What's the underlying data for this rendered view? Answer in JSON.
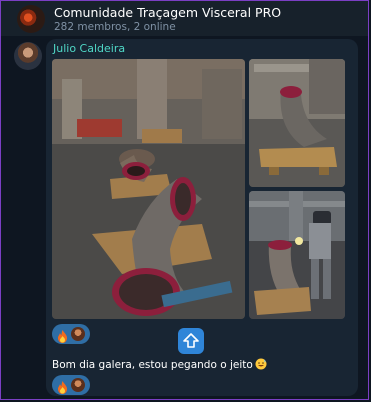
{
  "header": {
    "title": "Comunidade Traçagem Visceral PRO",
    "subtitle": "282 membros, 2 online"
  },
  "message": {
    "sender": "Julio Caldeira",
    "photos": [
      "pipe-elbows-workshop-photo",
      "pipe-elbow-on-pallet-photo",
      "welder-at-pipe-elbow-photo"
    ],
    "reactions": [
      "fire-icon",
      "reactor-avatar"
    ]
  },
  "text_message": {
    "text": "Bom dia galera, estou pegando o jeito",
    "emoji": "grinning-sweat-icon",
    "reactions": [
      "fire-icon",
      "reactor-avatar"
    ]
  },
  "colors": {
    "background": "#0e1621",
    "header": "#17212b",
    "bubble": "#182533",
    "sender_name": "#4fd7c6",
    "reaction_pill": "#2f6ea5",
    "scroll_button": "#2f85d8",
    "frame_border": "#7b3fc4"
  }
}
